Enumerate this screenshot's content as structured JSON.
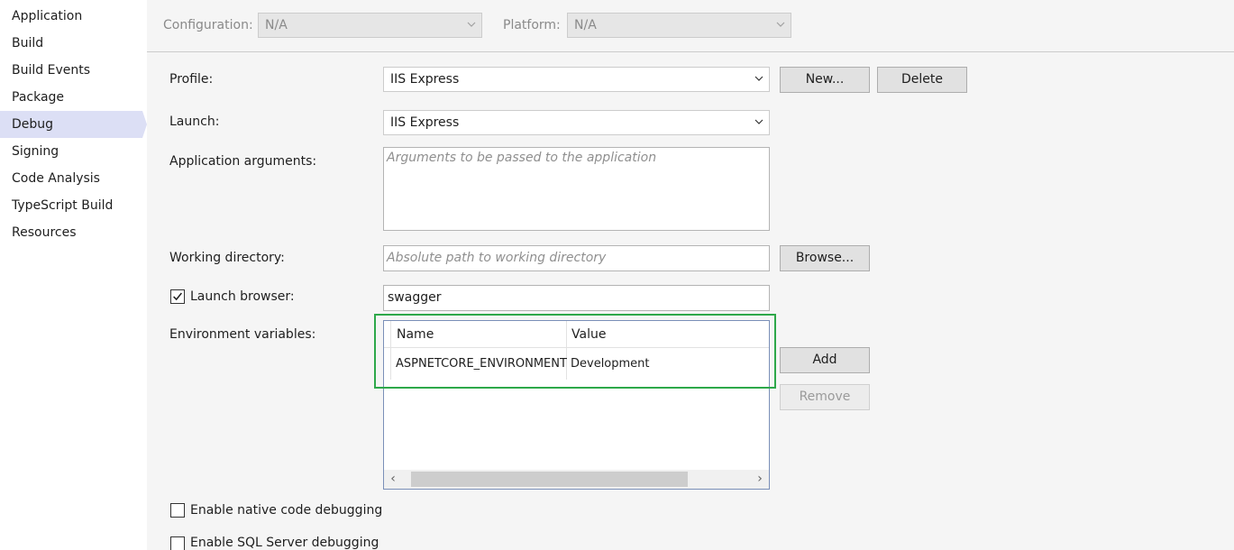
{
  "sidebar": {
    "items": [
      {
        "label": "Application"
      },
      {
        "label": "Build"
      },
      {
        "label": "Build Events"
      },
      {
        "label": "Package"
      },
      {
        "label": "Debug"
      },
      {
        "label": "Signing"
      },
      {
        "label": "Code Analysis"
      },
      {
        "label": "TypeScript Build"
      },
      {
        "label": "Resources"
      }
    ],
    "selected": "Debug"
  },
  "header": {
    "configuration_label": "Configuration:",
    "configuration_value": "N/A",
    "platform_label": "Platform:",
    "platform_value": "N/A"
  },
  "profile": {
    "label": "Profile:",
    "value": "IIS Express",
    "new_button": "New...",
    "delete_button": "Delete"
  },
  "launch": {
    "label": "Launch:",
    "value": "IIS Express"
  },
  "app_args": {
    "label": "Application arguments:",
    "placeholder": "Arguments to be passed to the application"
  },
  "working_dir": {
    "label": "Working directory:",
    "placeholder": "Absolute path to working directory",
    "browse_button": "Browse..."
  },
  "launch_browser": {
    "label": "Launch browser:",
    "checked": true,
    "value": "swagger"
  },
  "env_vars": {
    "label": "Environment variables:",
    "columns": [
      "Name",
      "Value"
    ],
    "rows": [
      {
        "name": "ASPNETCORE_ENVIRONMENT",
        "value": "Development"
      }
    ],
    "add_button": "Add",
    "remove_button": "Remove"
  },
  "options": {
    "native_debugging": {
      "label": "Enable native code debugging",
      "checked": false
    },
    "sql_debugging": {
      "label": "Enable SQL Server debugging",
      "checked": false
    }
  },
  "colors": {
    "highlight": "#2ea84a",
    "selected_nav": "#dcdff5"
  }
}
